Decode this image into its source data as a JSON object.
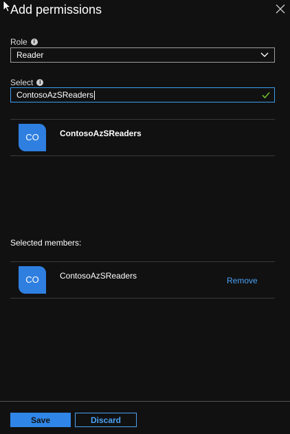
{
  "panel": {
    "title": "Add permissions"
  },
  "role": {
    "label": "Role",
    "value": "Reader"
  },
  "select": {
    "label": "Select",
    "value": "ContosoAzSReaders"
  },
  "search_results": [
    {
      "avatar_initials": "CO",
      "name": "ContosoAzSReaders"
    }
  ],
  "selected_members": {
    "label": "Selected members:",
    "items": [
      {
        "avatar_initials": "CO",
        "name": "ContosoAzSReaders",
        "remove_label": "Remove"
      }
    ]
  },
  "footer": {
    "save_label": "Save",
    "discard_label": "Discard"
  },
  "colors": {
    "background": "#111111",
    "accent": "#2f86e8",
    "link": "#4aa3f5",
    "avatar": "#2f7fe0",
    "valid_check": "#6fbf2f"
  },
  "icons": {
    "info": "info-icon",
    "close": "close-icon",
    "chevron": "chevron-down-icon",
    "check": "checkmark-icon",
    "cursor": "mouse-pointer-icon"
  }
}
